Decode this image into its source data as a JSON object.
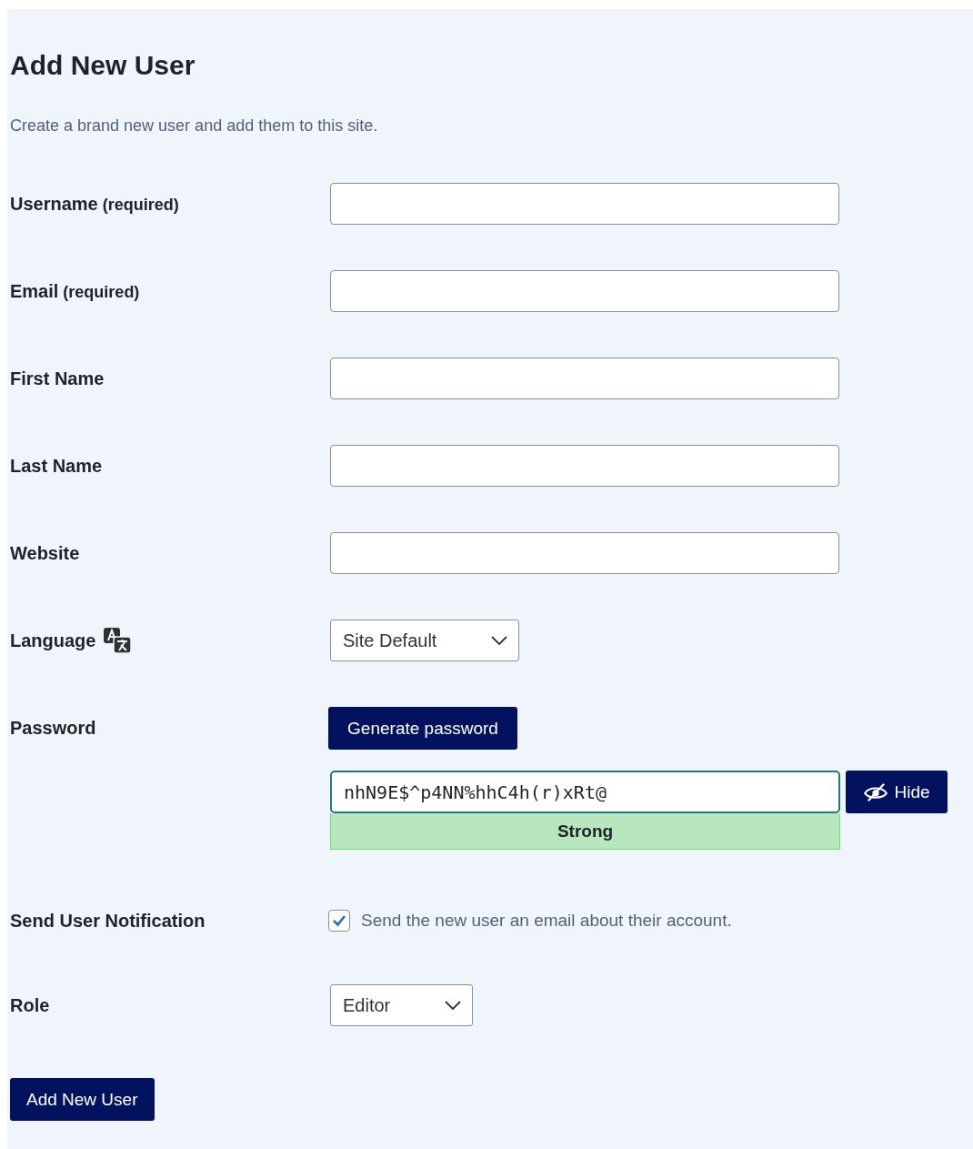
{
  "title": "Add New User",
  "description": "Create a brand new user and add them to this site.",
  "fields": [
    {
      "kind": "text",
      "label": "Username",
      "note": "(required)"
    },
    {
      "kind": "text",
      "label": "Email",
      "note": "(required)"
    },
    {
      "kind": "text",
      "label": "First Name"
    },
    {
      "kind": "text",
      "label": "Last Name"
    },
    {
      "kind": "text",
      "label": "Website"
    },
    {
      "kind": "select",
      "label": "Language",
      "has_icon": true,
      "value": "Site Default"
    },
    {
      "kind": "password",
      "label": "Password",
      "generate": "Generate password",
      "value": "nhN9E$^p4NN%hhC4h(r)xRt@",
      "toggle": "Hide",
      "strength": "Strong"
    },
    {
      "kind": "checkbox",
      "label": "Send User Notification",
      "checked": true,
      "text": "Send the new user an email about their account."
    },
    {
      "kind": "select",
      "label": "Role",
      "has_icon": false,
      "value": "Editor"
    }
  ],
  "submit": "Add New User"
}
